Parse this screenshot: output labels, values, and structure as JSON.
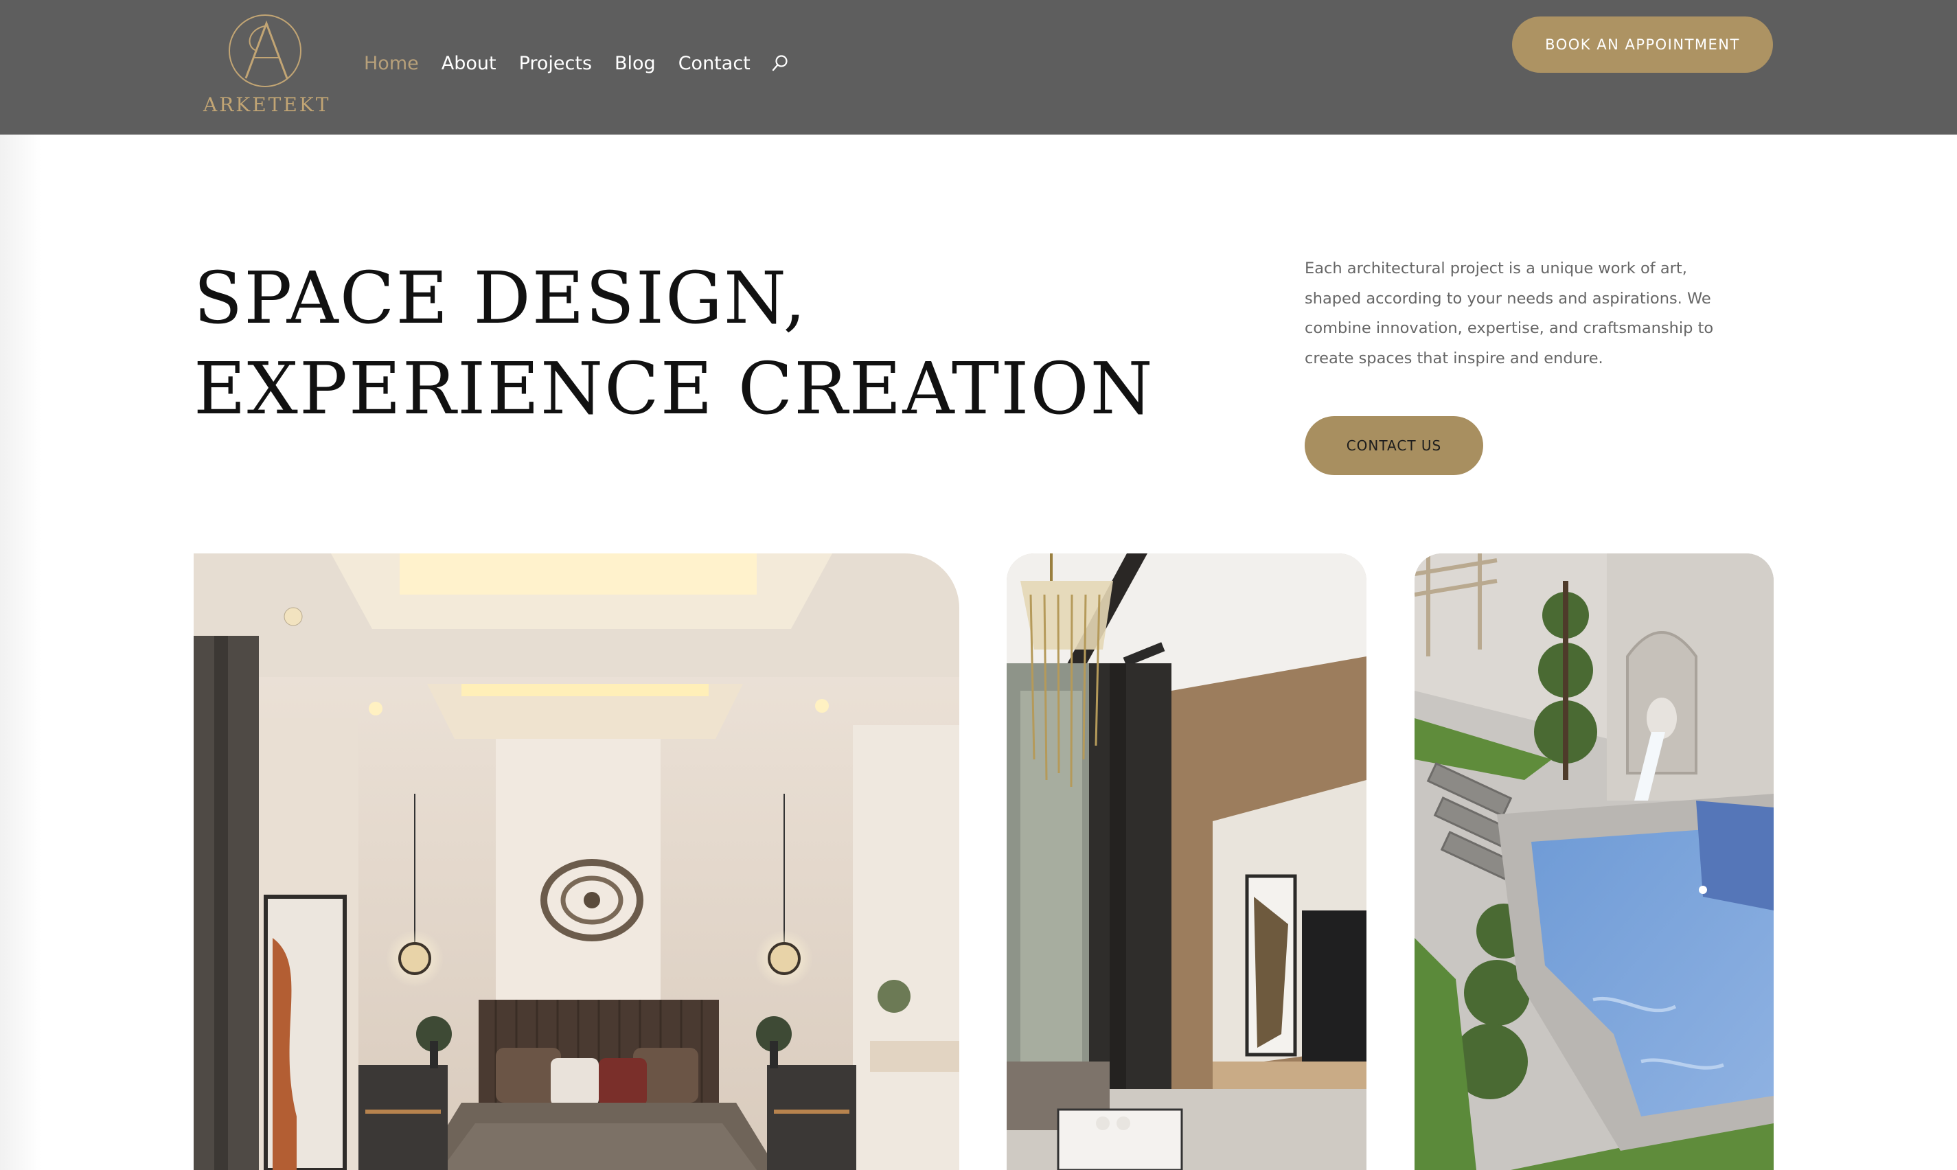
{
  "header": {
    "logo_text": "ARKETEKT",
    "nav": [
      {
        "label": "Home",
        "active": true
      },
      {
        "label": "About"
      },
      {
        "label": "Projects"
      },
      {
        "label": "Blog"
      },
      {
        "label": "Contact"
      }
    ],
    "search_icon": "search-icon",
    "cta_label": "BOOK AN APPOINTMENT"
  },
  "hero": {
    "title_line1": "SPACE DESIGN,",
    "title_line2": "EXPERIENCE CREATION",
    "description": "Each architectural project is a unique work of art, shaped according to your needs and aspirations. We combine innovation, expertise, and craftsmanship to create spaces that inspire and endure.",
    "contact_label": "CONTACT US"
  },
  "colors": {
    "header_bg": "#5e5e5e",
    "accent_gold": "#ad9363",
    "nav_active": "#b7a07a"
  }
}
